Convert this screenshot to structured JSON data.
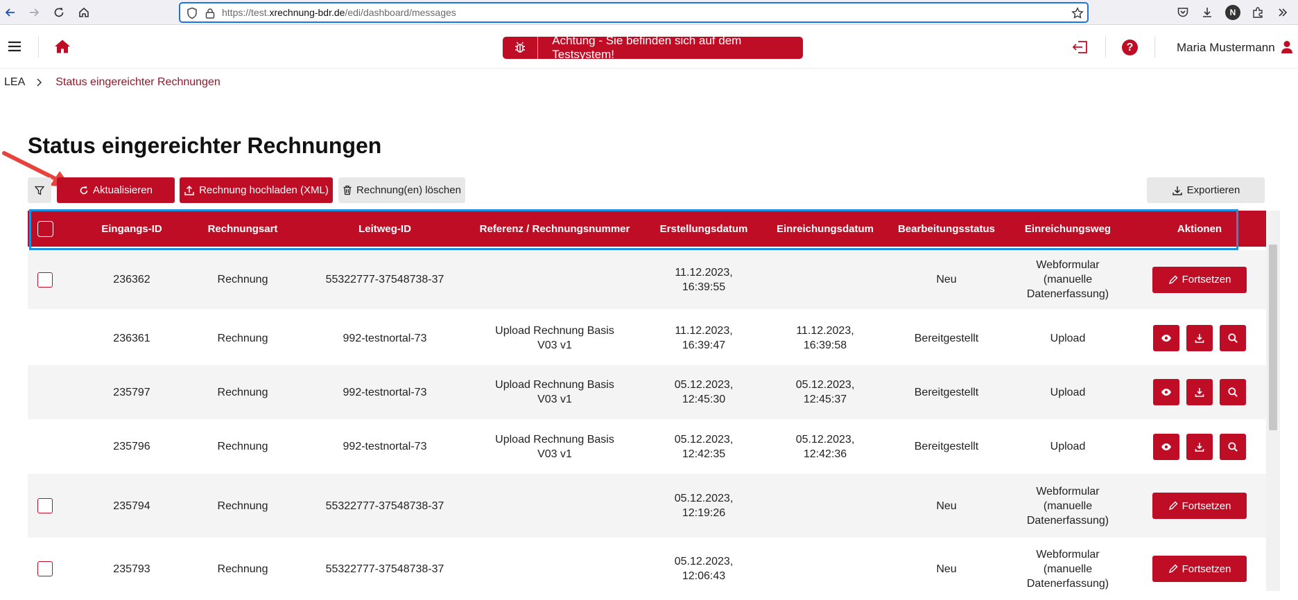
{
  "browser": {
    "url_prefix": "https://test.",
    "url_domain": "xrechnung-bdr.de",
    "url_path": "/edi/dashboard/messages",
    "profile_initial": "N"
  },
  "header": {
    "test_banner": "Achtung - Sie befinden sich auf dem Testsystem!",
    "user_name": "Maria Mustermann",
    "help_glyph": "?"
  },
  "breadcrumb": {
    "root": "LEA",
    "current": "Status eingereichter Rechnungen"
  },
  "page": {
    "title": "Status eingereichter Rechnungen"
  },
  "toolbar": {
    "refresh_label": "Aktualisieren",
    "upload_label": "Rechnung hochladen (XML)",
    "delete_label": "Rechnung(en) löschen",
    "export_label": "Exportieren"
  },
  "table": {
    "columns": [
      "Eingangs-ID",
      "Rechnungsart",
      "Leitweg-ID",
      "Referenz / Rechnungsnummer",
      "Erstellungsdatum",
      "Einreichungsdatum",
      "Bearbeitungsstatus",
      "Einreichungsweg",
      "Aktionen"
    ],
    "continue_label": "Fortsetzen",
    "rows": [
      {
        "id": "236362",
        "type": "Rechnung",
        "leitweg": "55322777-37548738-37",
        "ref": "",
        "created": "11.12.2023, 16:39:55",
        "submitted": "",
        "status": "Neu",
        "channel": "Webformular (manuelle Datenerfassung)",
        "actions": "continue",
        "selectable": true
      },
      {
        "id": "236361",
        "type": "Rechnung",
        "leitweg": "992-testnortal-73",
        "ref": "Upload Rechnung Basis V03 v1",
        "created": "11.12.2023, 16:39:47",
        "submitted": "11.12.2023, 16:39:58",
        "status": "Bereitgestellt",
        "channel": "Upload",
        "actions": "icons",
        "selectable": false
      },
      {
        "id": "235797",
        "type": "Rechnung",
        "leitweg": "992-testnortal-73",
        "ref": "Upload Rechnung Basis V03 v1",
        "created": "05.12.2023, 12:45:30",
        "submitted": "05.12.2023, 12:45:37",
        "status": "Bereitgestellt",
        "channel": "Upload",
        "actions": "icons",
        "selectable": false
      },
      {
        "id": "235796",
        "type": "Rechnung",
        "leitweg": "992-testnortal-73",
        "ref": "Upload Rechnung Basis V03 v1",
        "created": "05.12.2023, 12:42:35",
        "submitted": "05.12.2023, 12:42:36",
        "status": "Bereitgestellt",
        "channel": "Upload",
        "actions": "icons",
        "selectable": false
      },
      {
        "id": "235794",
        "type": "Rechnung",
        "leitweg": "55322777-37548738-37",
        "ref": "",
        "created": "05.12.2023, 12:19:26",
        "submitted": "",
        "status": "Neu",
        "channel": "Webformular (manuelle Datenerfassung)",
        "actions": "continue",
        "selectable": true
      },
      {
        "id": "235793",
        "type": "Rechnung",
        "leitweg": "55322777-37548738-37",
        "ref": "",
        "created": "05.12.2023, 12:06:43",
        "submitted": "",
        "status": "Neu",
        "channel": "Webformular (manuelle Datenerfassung)",
        "actions": "continue",
        "selectable": true
      }
    ]
  },
  "colors": {
    "primary": "#c00d26",
    "annotation_arrow": "#e8423c",
    "highlight_frame": "#1e90e0"
  },
  "icons": [
    "back-icon",
    "forward-icon",
    "reload-icon",
    "home-icon",
    "shield-icon",
    "lock-icon",
    "star-icon",
    "pocket-icon",
    "download-icon",
    "extensions-icon",
    "overflow-icon",
    "menu-icon",
    "house-icon",
    "bug-icon",
    "logout-icon",
    "help-icon",
    "user-icon",
    "filter-icon",
    "refresh-icon",
    "upload-icon",
    "trash-icon",
    "export-icon",
    "edit-icon",
    "eye-icon",
    "magnifier-icon"
  ]
}
